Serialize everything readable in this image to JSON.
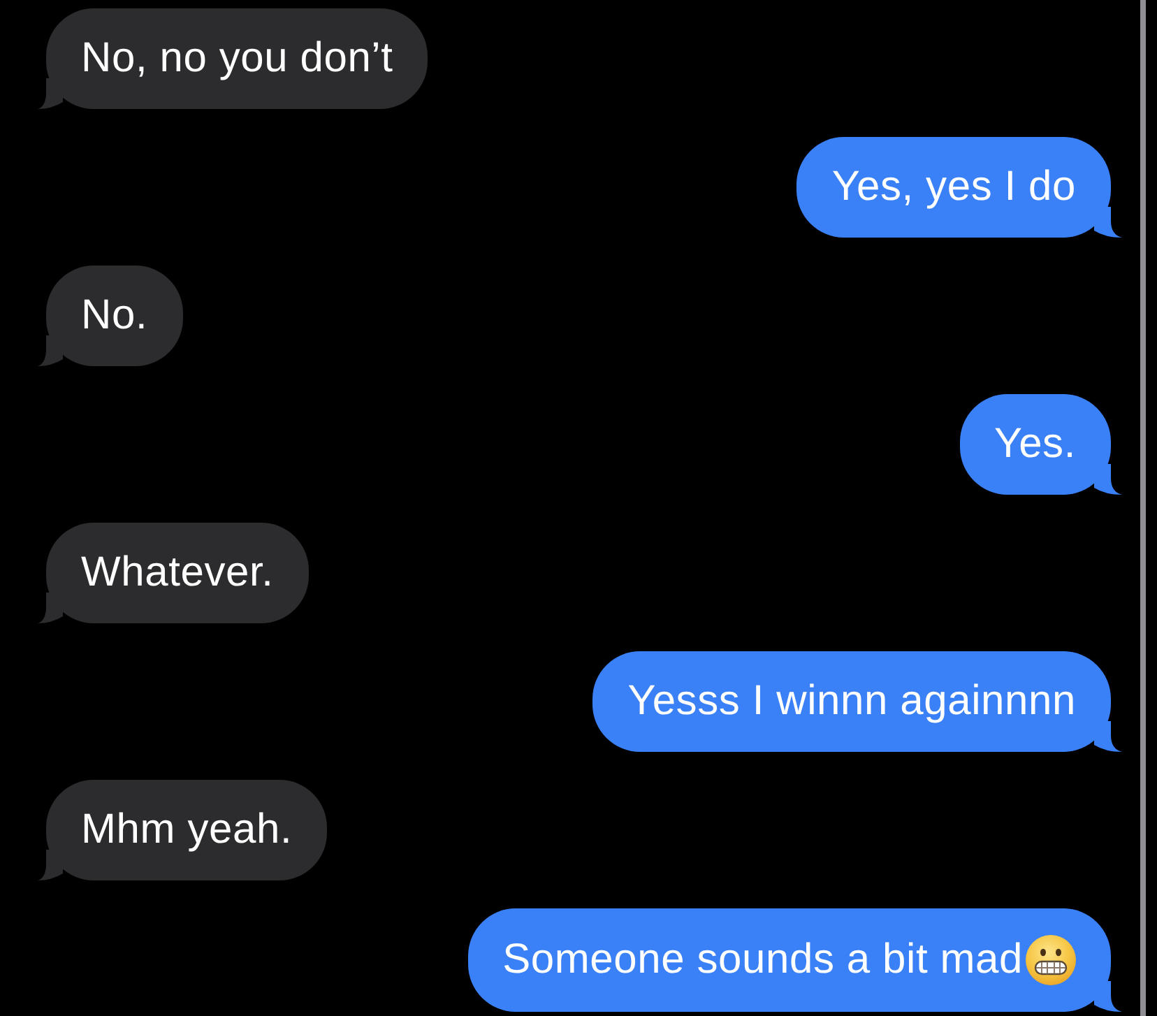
{
  "messages": [
    {
      "kind": "incoming",
      "text": "No, no you don’t",
      "trailing_emoji": false
    },
    {
      "kind": "outgoing",
      "text": "Yes, yes I do",
      "trailing_emoji": false
    },
    {
      "kind": "incoming",
      "text": "No.",
      "trailing_emoji": false
    },
    {
      "kind": "outgoing",
      "text": "Yes.",
      "trailing_emoji": false
    },
    {
      "kind": "incoming",
      "text": "Whatever.",
      "trailing_emoji": false
    },
    {
      "kind": "outgoing",
      "text": "Yesss I winnn againnnn",
      "trailing_emoji": false
    },
    {
      "kind": "incoming",
      "text": "Mhm yeah.",
      "trailing_emoji": false
    },
    {
      "kind": "outgoing",
      "text": "Someone sounds a bit mad",
      "trailing_emoji": true
    }
  ]
}
